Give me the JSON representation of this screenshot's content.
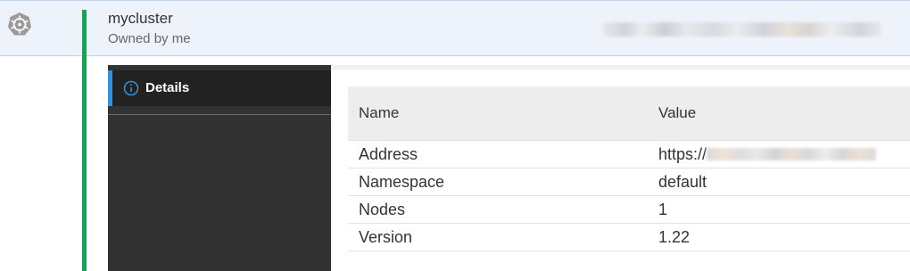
{
  "cluster": {
    "name": "mycluster",
    "owner": "Owned by me",
    "icon": "kubernetes-icon"
  },
  "sidebar": {
    "items": [
      {
        "label": "Details",
        "icon": "info-icon",
        "selected": true
      }
    ]
  },
  "details_table": {
    "headers": {
      "name": "Name",
      "value": "Value"
    },
    "rows": [
      {
        "name": "Address",
        "value": "https://"
      },
      {
        "name": "Namespace",
        "value": "default"
      },
      {
        "name": "Nodes",
        "value": "1"
      },
      {
        "name": "Version",
        "value": "1.22"
      }
    ]
  },
  "colors": {
    "accent_green": "#1e9e57",
    "selected_blue": "#3a8fd6",
    "sidebar_bg": "#323232",
    "header_bg": "#eef3fb"
  }
}
